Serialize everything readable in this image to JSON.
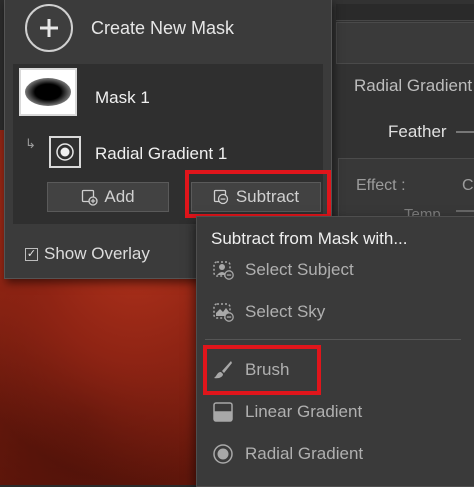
{
  "mask_panel": {
    "create_label": "Create New Mask",
    "masks": [
      {
        "name": "Mask 1",
        "components": [
          {
            "name": "Radial Gradient 1"
          }
        ]
      }
    ],
    "add_label": "Add",
    "subtract_label": "Subtract",
    "show_overlay_label": "Show Overlay",
    "show_overlay_checked": true
  },
  "right_panel": {
    "title": "Radial Gradient",
    "feather_label": "Feather",
    "effect_label": "Effect :",
    "effect_value_partial": "C",
    "temp_label": "Temp"
  },
  "subtract_menu": {
    "header": "Subtract from Mask with...",
    "items": [
      {
        "label": "Select Subject",
        "icon": "select-subject-icon"
      },
      {
        "label": "Select Sky",
        "icon": "select-sky-icon"
      },
      {
        "label": "Brush",
        "icon": "brush-icon"
      },
      {
        "label": "Linear Gradient",
        "icon": "linear-gradient-icon"
      },
      {
        "label": "Radial Gradient",
        "icon": "radial-gradient-icon"
      }
    ]
  },
  "colors": {
    "highlight": "#e0151b",
    "panel_bg": "#3b3b3b",
    "menu_bg": "#3a3a3a"
  }
}
